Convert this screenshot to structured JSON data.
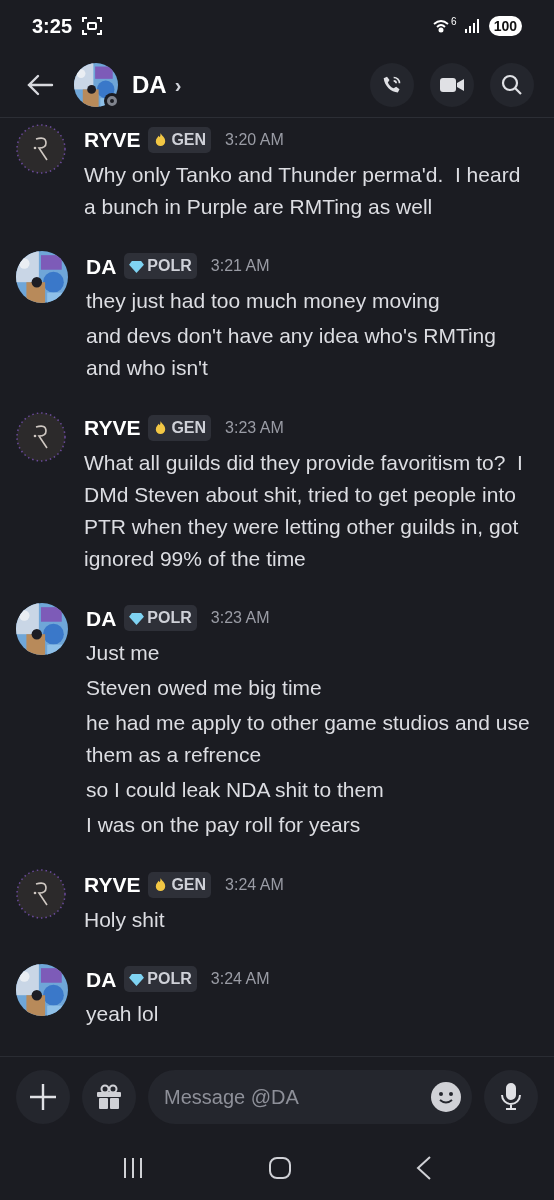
{
  "status_bar": {
    "time": "3:25",
    "wifi_label": "6",
    "battery": "100"
  },
  "header": {
    "name": "DA",
    "chevron": "›"
  },
  "messages": [
    {
      "author": "RYVE",
      "kind": "ryve",
      "tag": {
        "kind": "gen",
        "label": "GEN"
      },
      "time": "3:20 AM",
      "lines": [
        "Why only Tanko and Thunder perma'd.  I heard a bunch in Purple are RMTing as well"
      ]
    },
    {
      "author": "DA",
      "kind": "da",
      "tag": {
        "kind": "polr",
        "label": "POLR"
      },
      "time": "3:21 AM",
      "lines": [
        "they just had too much money moving",
        "and devs don't have any idea who's RMTing and who isn't"
      ]
    },
    {
      "author": "RYVE",
      "kind": "ryve",
      "tag": {
        "kind": "gen",
        "label": "GEN"
      },
      "time": "3:23 AM",
      "lines": [
        "What all guilds did they provide favoritism to?  I DMd Steven about shit, tried to get people into PTR when they were letting other guilds in, got ignored 99% of the time"
      ]
    },
    {
      "author": "DA",
      "kind": "da",
      "tag": {
        "kind": "polr",
        "label": "POLR"
      },
      "time": "3:23 AM",
      "lines": [
        "Just me",
        "Steven owed me big time",
        "he had me apply to other game studios and use them as a refrence",
        "so I could leak NDA shit to them",
        "I was on the pay roll for years"
      ]
    },
    {
      "author": "RYVE",
      "kind": "ryve",
      "tag": {
        "kind": "gen",
        "label": "GEN"
      },
      "time": "3:24 AM",
      "lines": [
        "Holy shit"
      ]
    },
    {
      "author": "DA",
      "kind": "da",
      "tag": {
        "kind": "polr",
        "label": "POLR"
      },
      "time": "3:24 AM",
      "lines": [
        "yeah lol"
      ]
    }
  ],
  "composer": {
    "placeholder": "Message @DA"
  }
}
